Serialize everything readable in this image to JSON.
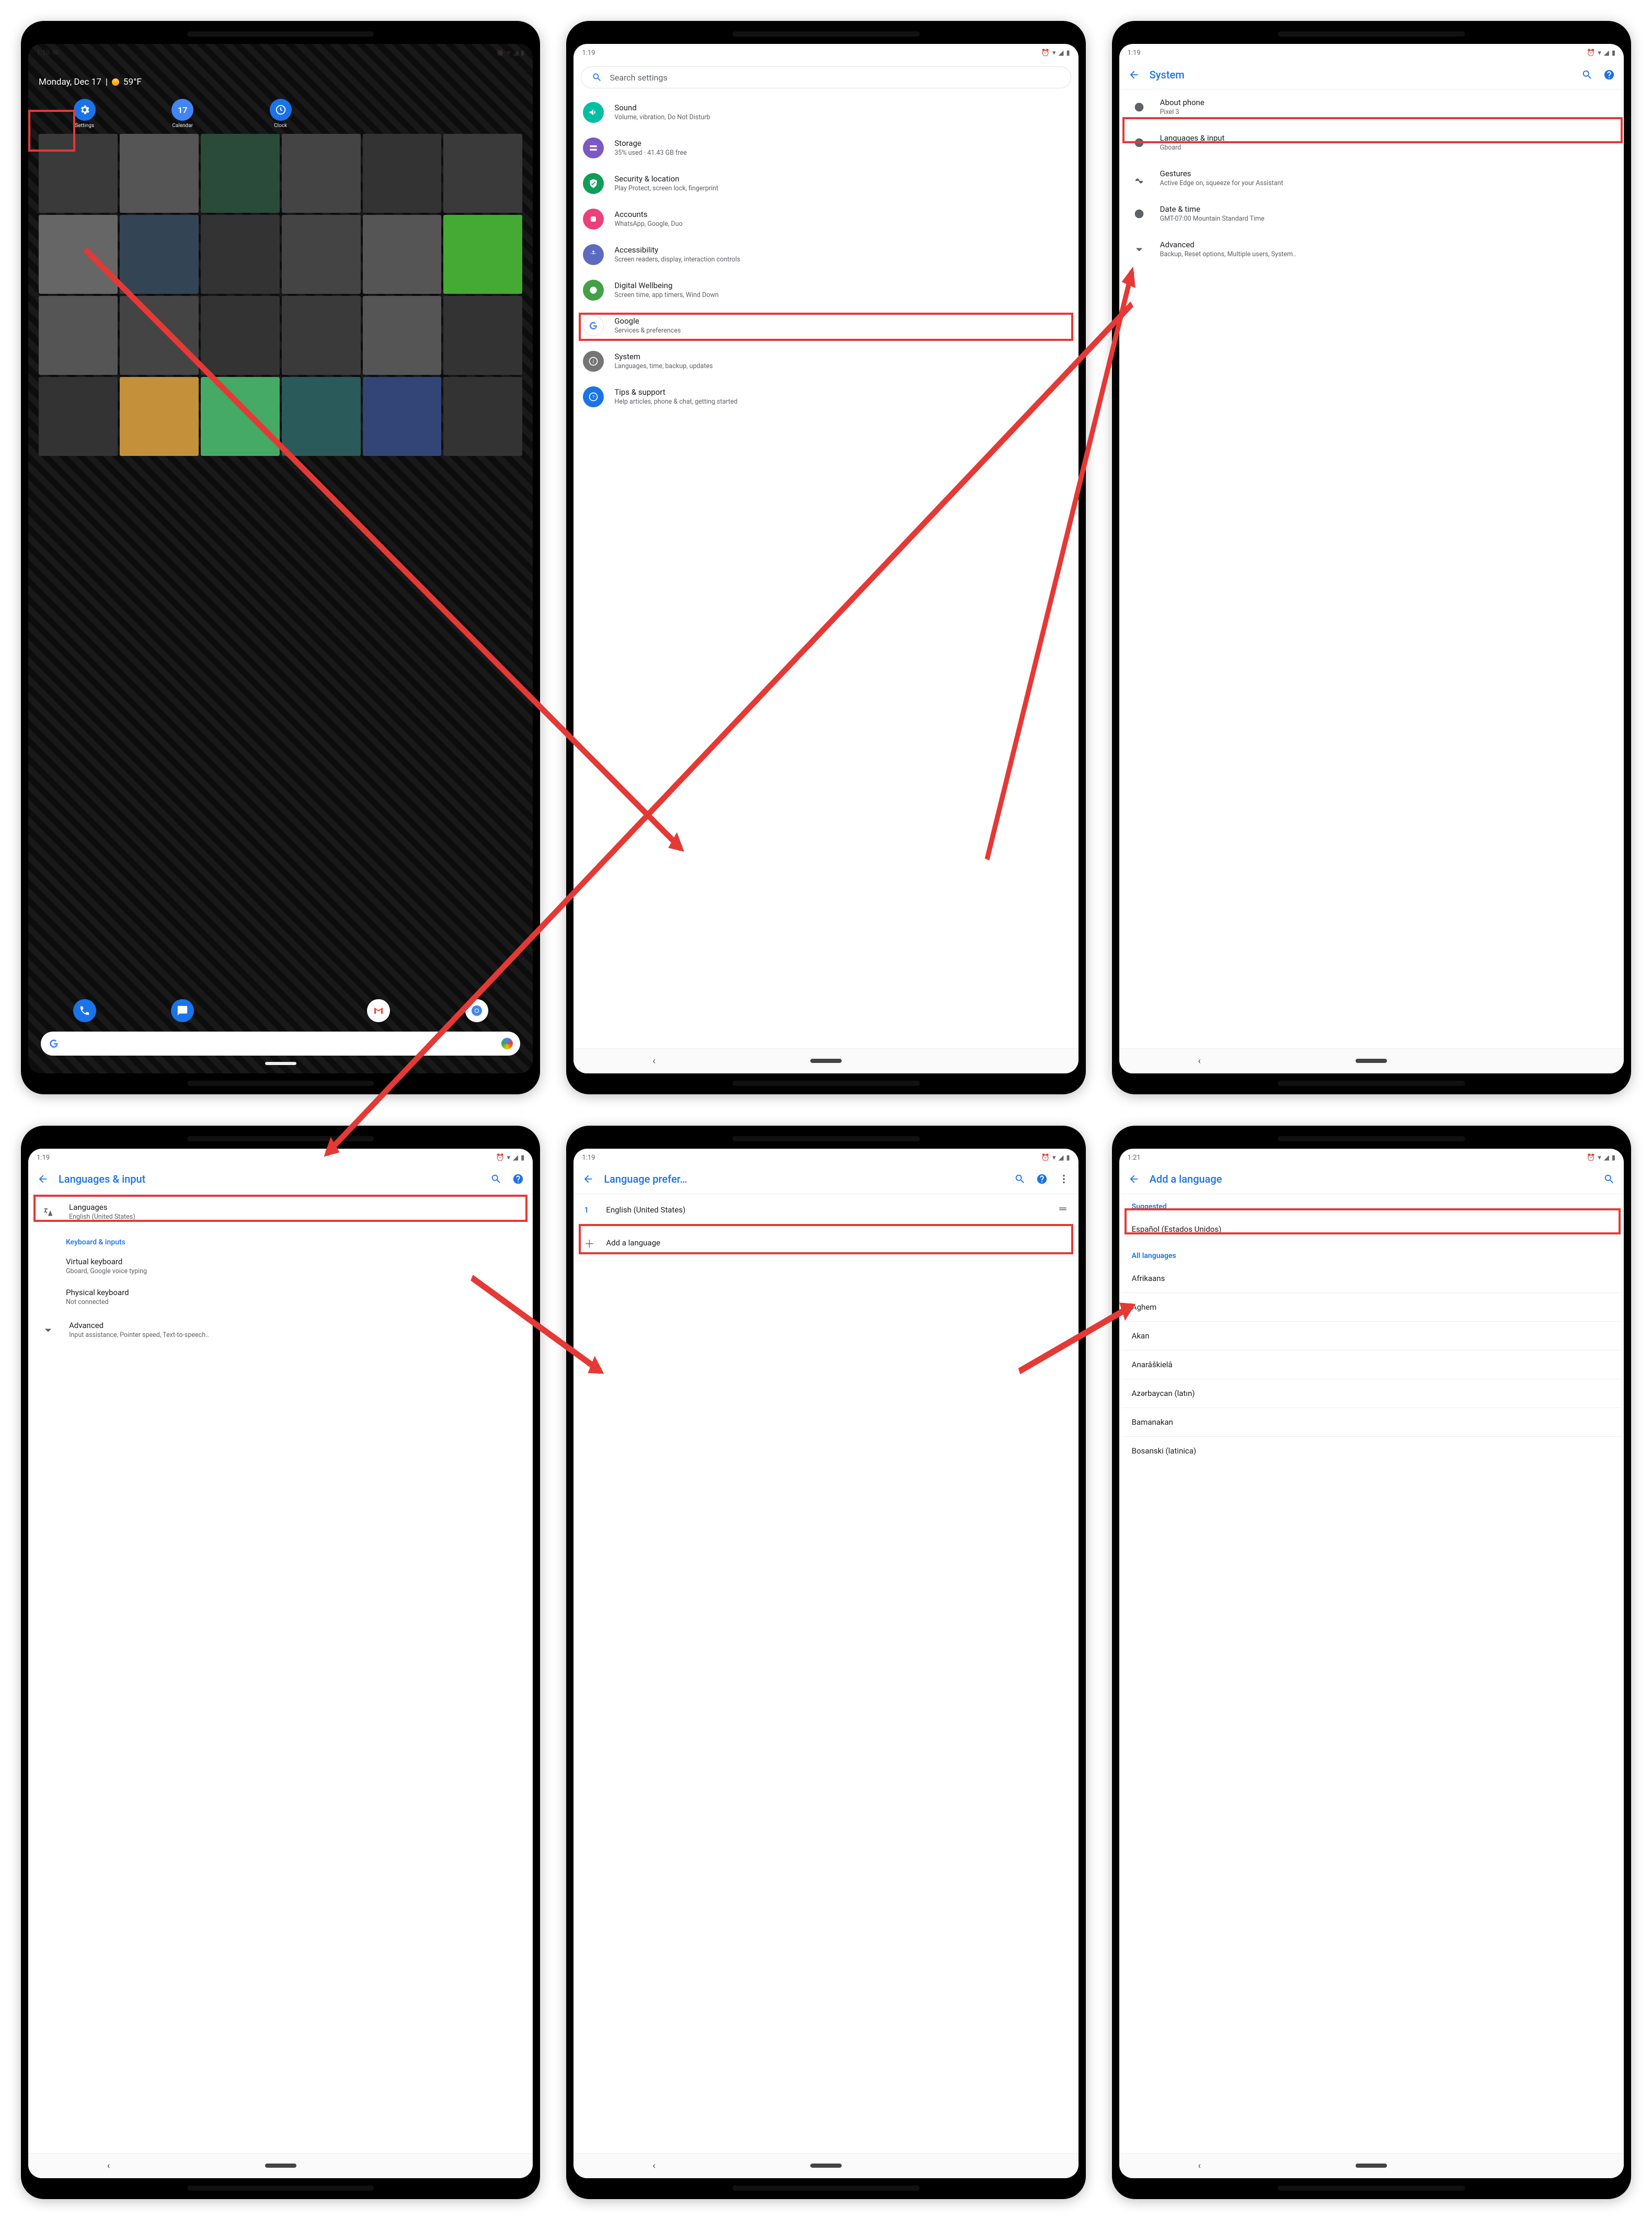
{
  "phones": {
    "home": {
      "time": "1:18",
      "date": "Monday, Dec 17",
      "weather": "59°F",
      "apps": [
        {
          "label": "Settings",
          "color": "#1a73e8"
        },
        {
          "label": "Calendar",
          "color": "#4285F4"
        },
        {
          "label": "Clock",
          "color": "#1a73e8"
        }
      ],
      "dock": [
        "Phone",
        "Messages",
        "",
        "Gmail",
        "Chrome"
      ]
    },
    "settings": {
      "time": "1:19",
      "search_placeholder": "Search settings",
      "items": [
        {
          "title": "Sound",
          "sub": "Volume, vibration, Do Not Disturb",
          "color": "#00bfa5"
        },
        {
          "title": "Storage",
          "sub": "35% used · 41.43 GB free",
          "color": "#7e57c2"
        },
        {
          "title": "Security & location",
          "sub": "Play Protect, screen lock, fingerprint",
          "color": "#0f9d58"
        },
        {
          "title": "Accounts",
          "sub": "WhatsApp, Google, Duo",
          "color": "#ec407a"
        },
        {
          "title": "Accessibility",
          "sub": "Screen readers, display, interaction controls",
          "color": "#5c6bc0"
        },
        {
          "title": "Digital Wellbeing",
          "sub": "Screen time, app timers, Wind Down",
          "color": "#43a047"
        },
        {
          "title": "Google",
          "sub": "Services & preferences",
          "color": "#ffffff"
        },
        {
          "title": "System",
          "sub": "Languages, time, backup, updates",
          "color": "#757575"
        },
        {
          "title": "Tips & support",
          "sub": "Help articles, phone & chat, getting started",
          "color": "#1a73e8"
        }
      ]
    },
    "system": {
      "time": "1:19",
      "title": "System",
      "items": [
        {
          "title": "About phone",
          "sub": "Pixel 3",
          "icon": "info"
        },
        {
          "title": "Languages & input",
          "sub": "Gboard",
          "icon": "globe"
        },
        {
          "title": "Gestures",
          "sub": "Active Edge on, squeeze for your Assistant",
          "icon": "gesture"
        },
        {
          "title": "Date & time",
          "sub": "GMT-07:00 Mountain Standard Time",
          "icon": "clock"
        },
        {
          "title": "Advanced",
          "sub": "Backup, Reset options, Multiple users, System..",
          "icon": "chevron"
        }
      ]
    },
    "lang_input": {
      "time": "1:19",
      "title": "Languages & input",
      "languages": {
        "title": "Languages",
        "sub": "English (United States)"
      },
      "section": "Keyboard & inputs",
      "items": [
        {
          "title": "Virtual keyboard",
          "sub": "Gboard, Google voice typing"
        },
        {
          "title": "Physical keyboard",
          "sub": "Not connected"
        }
      ],
      "advanced": {
        "title": "Advanced",
        "sub": "Input assistance, Pointer speed, Text-to-speech.."
      }
    },
    "lang_pref": {
      "time": "1:19",
      "title": "Language prefer…",
      "rows": [
        {
          "n": "1",
          "label": "English (United States)"
        }
      ],
      "add": "Add a language"
    },
    "add_lang": {
      "time": "1:21",
      "title": "Add a language",
      "suggested_label": "Suggested",
      "suggested": [
        "Español (Estados Unidos)"
      ],
      "all_label": "All languages",
      "all": [
        "Afrikaans",
        "Aghem",
        "Akan",
        "Anarâškielâ",
        "Azərbaycan (latın)",
        "Bamanakan",
        "Bosanski (latinica)"
      ]
    }
  }
}
